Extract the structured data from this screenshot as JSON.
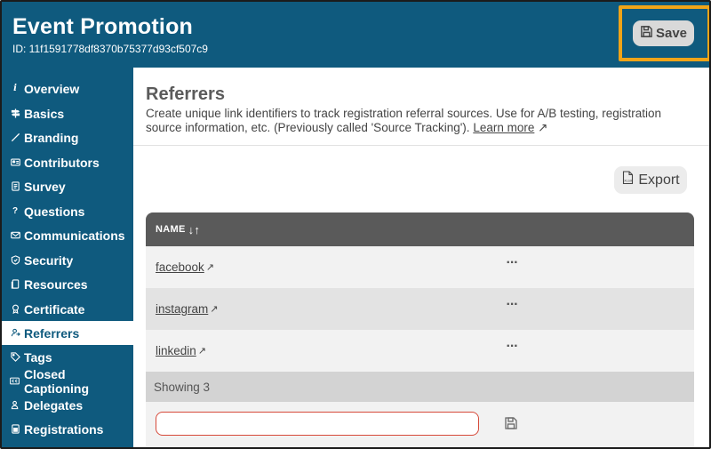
{
  "header": {
    "title": "Event Promotion",
    "id_text": "ID: 11f1591778df8370b75377d93cf507c9",
    "save_label": "Save"
  },
  "sidebar": {
    "items": [
      {
        "label": "Overview",
        "icon": "info-icon"
      },
      {
        "label": "Basics",
        "icon": "signpost-icon"
      },
      {
        "label": "Branding",
        "icon": "brush-icon"
      },
      {
        "label": "Contributors",
        "icon": "id-card-icon"
      },
      {
        "label": "Survey",
        "icon": "list-icon"
      },
      {
        "label": "Questions",
        "icon": "question-icon"
      },
      {
        "label": "Communications",
        "icon": "mail-icon"
      },
      {
        "label": "Security",
        "icon": "shield-icon"
      },
      {
        "label": "Resources",
        "icon": "file-icon"
      },
      {
        "label": "Certificate",
        "icon": "award-icon"
      },
      {
        "label": "Referrers",
        "icon": "referrer-icon",
        "active": true
      },
      {
        "label": "Tags",
        "icon": "tag-icon"
      },
      {
        "label": "Closed Captioning",
        "icon": "cc-icon"
      },
      {
        "label": "Delegates",
        "icon": "people-icon"
      },
      {
        "label": "Registrations",
        "icon": "registrations-icon"
      }
    ]
  },
  "main": {
    "title": "Referrers",
    "description": "Create unique link identifiers to track registration referral sources. Use for A/B testing, registration source information, etc. (Previously called 'Source Tracking'). ",
    "learn_more": "Learn more",
    "export_label": "Export",
    "table": {
      "column_name": "NAME",
      "rows": [
        {
          "name": "facebook"
        },
        {
          "name": "instagram"
        },
        {
          "name": "linkedin"
        }
      ],
      "showing": "Showing 3",
      "new_value": ""
    }
  },
  "colors": {
    "brand": "#0f5a7e",
    "highlight": "#f0a418",
    "input_border": "#d64a3a"
  }
}
